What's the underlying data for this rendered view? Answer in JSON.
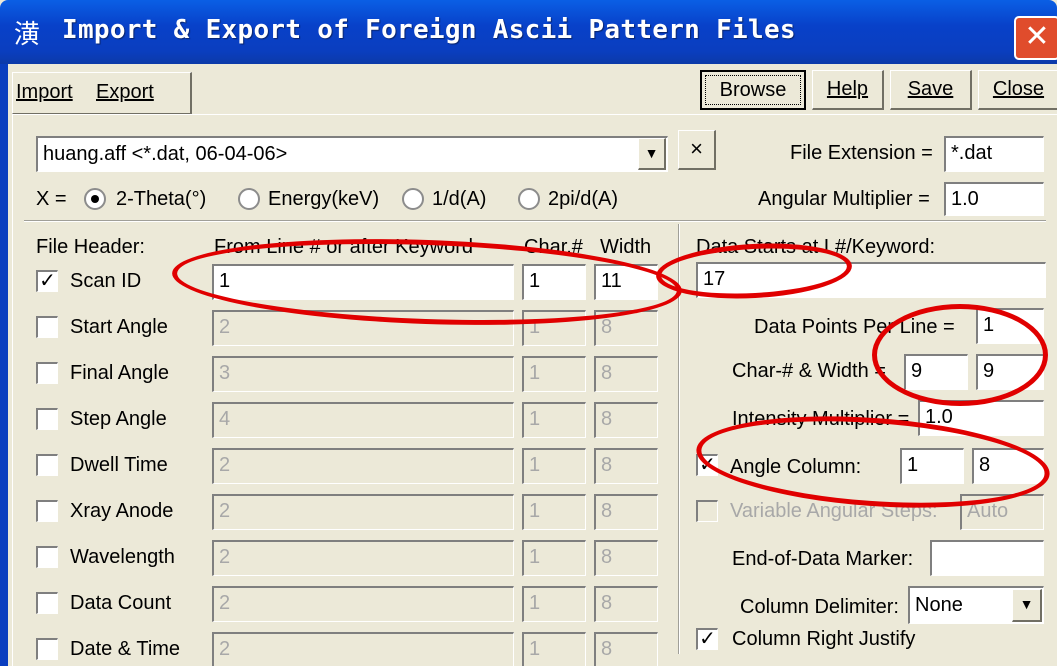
{
  "window": {
    "title": "Import & Export of Foreign Ascii Pattern Files",
    "icon": "潢",
    "close_glyph": "✕"
  },
  "tabs": [
    {
      "label": "Import"
    },
    {
      "label": "Export"
    }
  ],
  "toolbar": {
    "browse": "Browse",
    "help": "Help",
    "save": "Save",
    "close": "Close"
  },
  "format": {
    "selected": "huang.aff <*.dat, 06-04-06>",
    "delete_glyph": "×",
    "file_extension_label": "File Extension =",
    "file_extension_value": "*.dat"
  },
  "x_axis": {
    "label": "X =",
    "options": [
      {
        "label": "2-Theta(°)",
        "selected": true
      },
      {
        "label": "Energy(keV)",
        "selected": false
      },
      {
        "label": "1/d(A)",
        "selected": false
      },
      {
        "label": "2pi/d(A)",
        "selected": false
      }
    ],
    "angular_multiplier_label": "Angular Multiplier =",
    "angular_multiplier_value": "1.0"
  },
  "header": {
    "title": "File Header:",
    "col_from": "From Line # or after Keyword",
    "col_char": "Char.#",
    "col_width": "Width",
    "rows": [
      {
        "label": "Scan ID",
        "checked": true,
        "line": "1",
        "char": "1",
        "width": "11"
      },
      {
        "label": "Start Angle",
        "checked": false,
        "line": "2",
        "char": "1",
        "width": "8"
      },
      {
        "label": "Final Angle",
        "checked": false,
        "line": "3",
        "char": "1",
        "width": "8"
      },
      {
        "label": "Step Angle",
        "checked": false,
        "line": "4",
        "char": "1",
        "width": "8"
      },
      {
        "label": "Dwell Time",
        "checked": false,
        "line": "2",
        "char": "1",
        "width": "8"
      },
      {
        "label": "Xray Anode",
        "checked": false,
        "line": "2",
        "char": "1",
        "width": "8"
      },
      {
        "label": "Wavelength",
        "checked": false,
        "line": "2",
        "char": "1",
        "width": "8"
      },
      {
        "label": "Data Count",
        "checked": false,
        "line": "2",
        "char": "1",
        "width": "8"
      },
      {
        "label": "Date & Time",
        "checked": false,
        "line": "2",
        "char": "1",
        "width": "8"
      }
    ]
  },
  "data": {
    "starts_label": "Data Starts at L#/Keyword:",
    "starts_value": "17",
    "points_per_line_label": "Data Points Per Line =",
    "points_per_line_value": "1",
    "char_width_label": "Char-# & Width =",
    "char_value": "9",
    "width_value": "9",
    "intensity_label": "Intensity Multiplier =",
    "intensity_value": "1.0",
    "angle_column_label": "Angle Column:",
    "angle_column_checked": true,
    "angle_char": "1",
    "angle_width": "8",
    "variable_steps_label": "Variable Angular Steps:",
    "variable_steps_value": "Auto",
    "end_marker_label": "End-of-Data Marker:",
    "end_marker_value": "",
    "delimiter_label": "Column Delimiter:",
    "delimiter_value": "None",
    "right_justify_label": "Column Right Justify",
    "right_justify_checked": true
  },
  "colors": {
    "annotation": "#e00000",
    "titlebar": "#0a3ebf"
  }
}
